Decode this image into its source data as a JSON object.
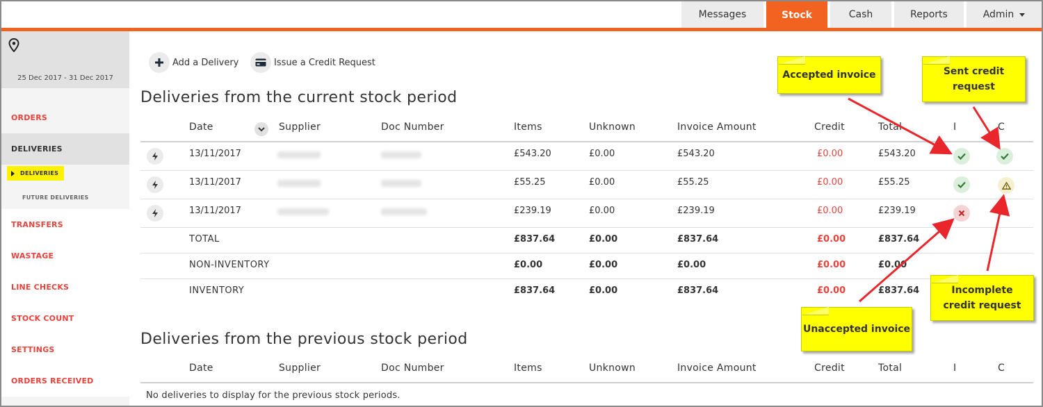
{
  "nav": {
    "tabs": [
      {
        "label": "Messages"
      },
      {
        "label": "Stock"
      },
      {
        "label": "Cash"
      },
      {
        "label": "Reports"
      },
      {
        "label": "Admin"
      }
    ],
    "active_tab": "Stock"
  },
  "sidebar": {
    "location_icon": "map-pin-icon",
    "date_range": "25 Dec 2017 - 31 Dec 2017",
    "items": [
      {
        "label": "ORDERS"
      },
      {
        "label": "DELIVERIES"
      },
      {
        "label": "TRANSFERS"
      },
      {
        "label": "WASTAGE"
      },
      {
        "label": "LINE CHECKS"
      },
      {
        "label": "STOCK COUNT"
      },
      {
        "label": "SETTINGS"
      },
      {
        "label": "ORDERS RECEIVED"
      }
    ],
    "sub_items": [
      {
        "label": "DELIVERIES"
      },
      {
        "label": "FUTURE DELIVERIES"
      }
    ]
  },
  "actions": {
    "add_delivery": "Add a Delivery",
    "credit_request": "Issue a Credit Request"
  },
  "current": {
    "title": "Deliveries from the current stock period",
    "headers": [
      "Date",
      "Supplier",
      "Doc Number",
      "Items",
      "Unknown",
      "Invoice Amount",
      "Credit",
      "Total",
      "I",
      "C"
    ],
    "rows": [
      {
        "date": "13/11/2017",
        "items": "£543.20",
        "unknown": "£0.00",
        "invoice": "£543.20",
        "credit": "£0.00",
        "total": "£543.20",
        "i_status": "accepted",
        "c_status": "sent"
      },
      {
        "date": "13/11/2017",
        "items": "£55.25",
        "unknown": "£0.00",
        "invoice": "£55.25",
        "credit": "£0.00",
        "total": "£55.25",
        "i_status": "accepted",
        "c_status": "incomplete"
      },
      {
        "date": "13/11/2017",
        "items": "£239.19",
        "unknown": "£0.00",
        "invoice": "£239.19",
        "credit": "£0.00",
        "total": "£239.19",
        "i_status": "unaccepted",
        "c_status": "none"
      }
    ],
    "summary": [
      {
        "label": "TOTAL",
        "items": "£837.64",
        "unknown": "£0.00",
        "invoice": "£837.64",
        "credit": "£0.00",
        "total": "£837.64"
      },
      {
        "label": "NON-INVENTORY",
        "items": "£0.00",
        "unknown": "£0.00",
        "invoice": "£0.00",
        "credit": "£0.00",
        "total": "£0.00"
      },
      {
        "label": "INVENTORY",
        "items": "£837.64",
        "unknown": "£0.00",
        "invoice": "£837.64",
        "credit": "£0.00",
        "total": "£837.64"
      }
    ]
  },
  "previous": {
    "title": "Deliveries from the previous stock period",
    "headers": [
      "Date",
      "Supplier",
      "Doc Number",
      "Items",
      "Unknown",
      "Invoice Amount",
      "Credit",
      "Total",
      "I",
      "C"
    ],
    "empty": "No deliveries to display for the previous stock periods."
  },
  "callouts": {
    "accepted": "Accepted invoice",
    "sent_credit": "Sent credit request",
    "unaccepted": "Unaccepted invoice",
    "incomplete_credit": "Incomplete credit request"
  },
  "colors": {
    "accent": "#f26322",
    "credit_red": "#e8433c",
    "callout": "#ffff00",
    "arrow": "#e8262b"
  }
}
